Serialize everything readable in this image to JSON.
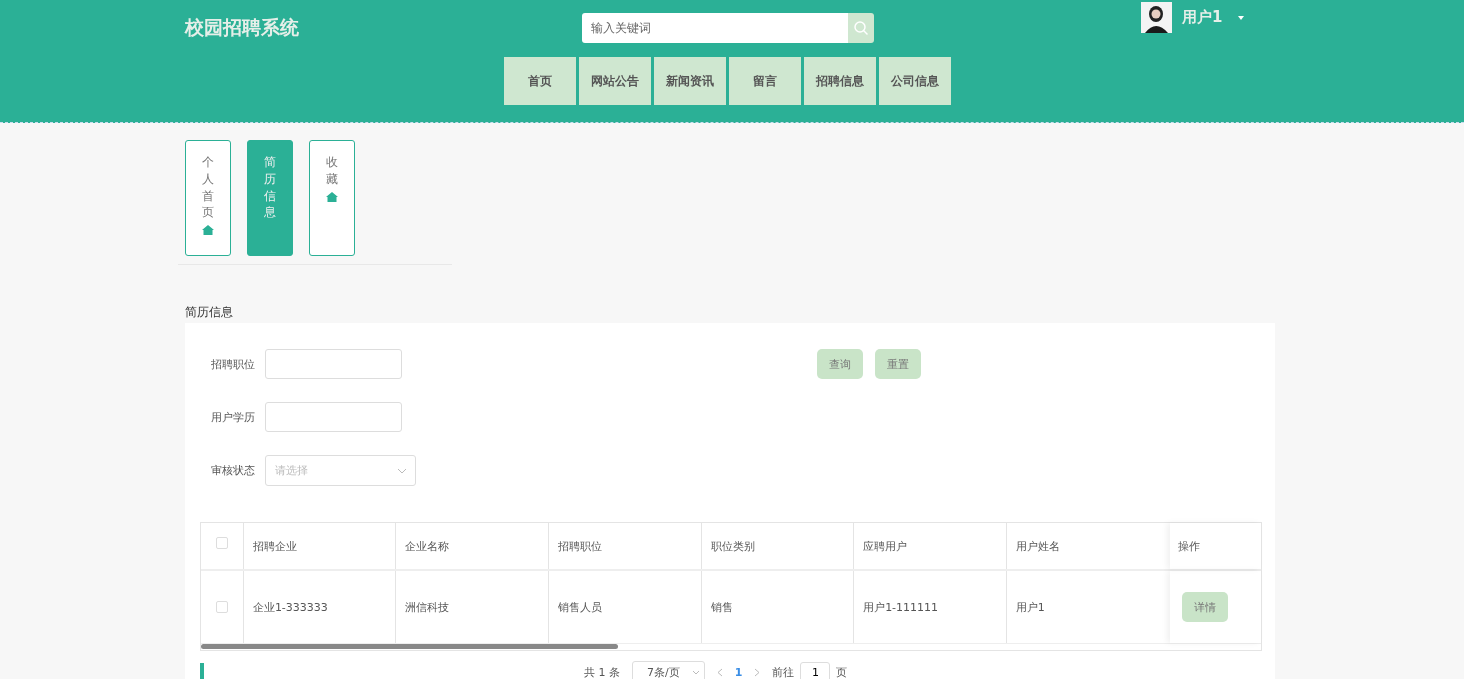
{
  "header": {
    "title": "校园招聘系统",
    "search": {
      "placeholder": "输入关键词"
    },
    "user": {
      "name": "用户1"
    }
  },
  "nav": [
    {
      "label": "首页"
    },
    {
      "label": "网站公告"
    },
    {
      "label": "新闻资讯"
    },
    {
      "label": "留言"
    },
    {
      "label": "招聘信息"
    },
    {
      "label": "公司信息"
    }
  ],
  "side_tabs": [
    {
      "label": "个人首页",
      "selected": false,
      "icon": true
    },
    {
      "label": "简历信息",
      "selected": true,
      "icon": false
    },
    {
      "label": "收藏",
      "selected": false,
      "icon": true
    }
  ],
  "section_title": "简历信息",
  "filters": [
    {
      "label": "招聘职位",
      "kind": "input"
    },
    {
      "label": "用户学历",
      "kind": "input"
    },
    {
      "label": "审核状态",
      "kind": "select",
      "placeholder": "请选择"
    }
  ],
  "buttons": [
    "查询",
    "重置"
  ],
  "table": {
    "all_checked": false,
    "columns": [
      "招聘企业",
      "企业名称",
      "招聘职位",
      "职位类别",
      "应聘用户",
      "用户姓名"
    ],
    "action_column": "操作",
    "rows": [
      {
        "checked": false,
        "cells": [
          "企业1-333333",
          "洲信科技",
          "销售人员",
          "销售",
          "用户1-111111",
          "用户1"
        ],
        "action": "详情"
      }
    ]
  },
  "pagination": {
    "total": "共 1 条",
    "page_size": "7条/页",
    "pages": [
      {
        "label": "1",
        "selected": true
      }
    ],
    "goto_label": "前往",
    "goto_value": "1",
    "goto_suffix": "页"
  }
}
